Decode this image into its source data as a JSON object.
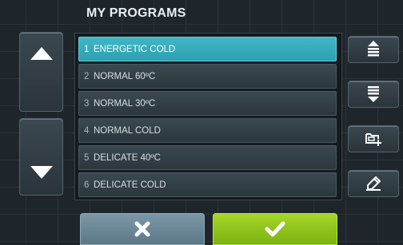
{
  "screen": {
    "title": "MY PROGRAMS"
  },
  "programs": [
    {
      "number": "1",
      "name": "ENERGETIC COLD",
      "selected": true
    },
    {
      "number": "2",
      "name": "NORMAL 60ºC",
      "selected": false
    },
    {
      "number": "3",
      "name": "NORMAL 30ºC",
      "selected": false
    },
    {
      "number": "4",
      "name": "NORMAL COLD",
      "selected": false
    },
    {
      "number": "5",
      "name": "DELICATE 40ºC",
      "selected": false
    },
    {
      "number": "6",
      "name": "DELICATE COLD",
      "selected": false
    }
  ],
  "icons": {
    "scroll_up": "triangle-up-icon",
    "scroll_down": "triangle-down-icon",
    "move_up": "move-up-icon",
    "move_down": "move-down-icon",
    "add_folder": "folder-add-icon",
    "edit": "pencil-icon",
    "cancel": "cross-icon",
    "confirm": "check-icon"
  },
  "colors": {
    "selected_row": "#35a9ba",
    "confirm_button": "#8fc41b",
    "cancel_button": "#6c8897",
    "background": "#1f262b"
  }
}
